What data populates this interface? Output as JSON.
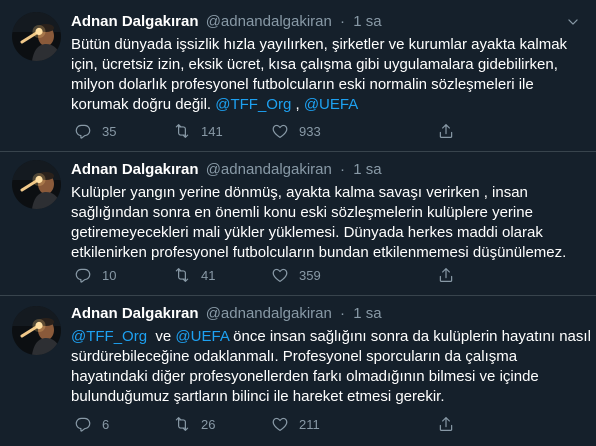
{
  "colors": {
    "background": "#15202b",
    "divider": "#38444d",
    "text": "#ffffff",
    "muted": "#8899a6",
    "link": "#1da1f2"
  },
  "icons": {
    "reply": "reply-icon",
    "retweet": "retweet-icon",
    "like": "heart-icon",
    "share": "share-icon",
    "menu": "chevron-down-icon"
  },
  "tweets": [
    {
      "name": "Adnan Dalgakıran",
      "handle": "@adnandalgakiran",
      "dot": "·",
      "time": "1 sa",
      "lines": [
        "Bütün dünyada işsizlik hızla yayılırken, şirketler ve kurumlar ayakta kalmak",
        "için, ücretsiz izin, eksik ücret, kısa çalışma gibi uygulamalara gidebilirken,",
        "milyon dolarlık profesyonel futbolcuların eski normalin sözleşmeleri ile"
      ],
      "last_line": {
        "text": "korumak doğru değil.",
        "mention1": "@TFF_Org",
        "sep": " , ",
        "mention2": "@UEFA"
      },
      "replies": "35",
      "retweets": "141",
      "likes": "933"
    },
    {
      "name": "Adnan Dalgakıran",
      "handle": "@adnandalgakiran",
      "dot": "·",
      "time": "1 sa",
      "lines": [
        "Kulüpler yangın yerine dönmüş, ayakta kalma savaşı verirken , insan",
        "sağlığından sonra en önemli konu eski sözleşmelerin kulüplere yerine",
        "getiremeyecekleri mali yükler yüklemesi. Dünyada herkes maddi olarak",
        "etkilenirken profesyonel futbolcuların bundan etkilenmemesi düşünülemez."
      ],
      "replies": "10",
      "retweets": "41",
      "likes": "359"
    },
    {
      "name": "Adnan Dalgakıran",
      "handle": "@adnandalgakiran",
      "dot": "·",
      "time": "1 sa",
      "first_line": {
        "mention1": "@TFF_Org",
        "sep": "  ve ",
        "mention2": "@UEFA",
        "text": " önce insan sağlığını sonra da kulüplerin hayatını nasıl"
      },
      "lines": [
        "sürdürebileceğine odaklanmalı. Profesyonel sporcuların da çalışma",
        "hayatındaki diğer profesyonellerden farkı olmadığının bilmesi ve içinde",
        "bulunduğumuz şartların bilinci ile hareket etmesi gerekir."
      ],
      "replies": "6",
      "retweets": "26",
      "likes": "211"
    }
  ]
}
